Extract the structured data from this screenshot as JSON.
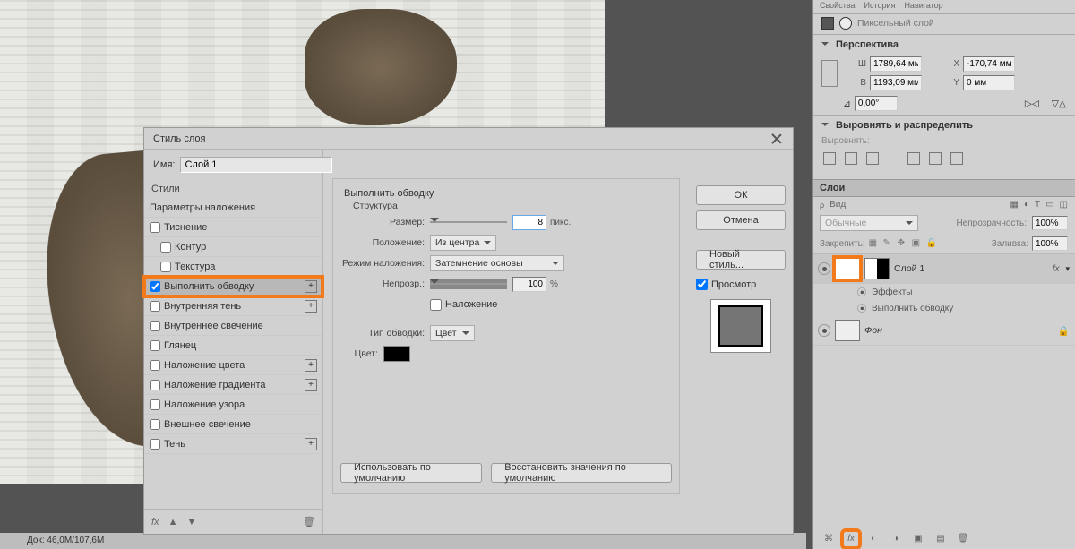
{
  "status_bar": {
    "doc_info": "Док: 46,0M/107,6M"
  },
  "dialog": {
    "title": "Стиль слоя",
    "name_label": "Имя:",
    "name_value": "Слой 1",
    "styles_header": "Стили",
    "effects": {
      "blending": "Параметры наложения",
      "bevel": "Тиснение",
      "contour": "Контур",
      "texture": "Текстура",
      "stroke": "Выполнить обводку",
      "inner_shadow": "Внутренняя тень",
      "inner_glow": "Внутреннее свечение",
      "satin": "Глянец",
      "color_overlay": "Наложение цвета",
      "gradient_overlay": "Наложение градиента",
      "pattern_overlay": "Наложение узора",
      "outer_glow": "Внешнее свечение",
      "drop_shadow": "Тень"
    },
    "stroke_panel": {
      "title": "Выполнить обводку",
      "structure": "Структура",
      "size_label": "Размер:",
      "size_value": "8",
      "size_unit": "пикс.",
      "position_label": "Положение:",
      "position_value": "Из центра",
      "blend_label": "Режим наложения:",
      "blend_value": "Затемнение основы",
      "opacity_label": "Непрозр.:",
      "opacity_value": "100",
      "opacity_unit": "%",
      "overprint": "Наложение",
      "type_label": "Тип обводки:",
      "type_value": "Цвет",
      "color_label": "Цвет:",
      "make_default": "Использовать по умолчанию",
      "reset_default": "Восстановить значения по умолчанию"
    },
    "buttons": {
      "ok": "ОК",
      "cancel": "Отмена",
      "new_style": "Новый стиль...",
      "preview": "Просмотр"
    },
    "footer_fx": "fx"
  },
  "panel": {
    "tabs": [
      "Свойства",
      "История",
      "Навигатор"
    ],
    "layer_kind": "Пиксельный слой",
    "perspective": {
      "title": "Перспектива",
      "w_label": "Ш",
      "w_value": "1789,64 мм",
      "x_label": "X",
      "x_value": "-170,74 мм",
      "h_label": "В",
      "h_value": "1193,09 мм",
      "y_label": "Y",
      "y_value": "0 мм",
      "angle_value": "0,00°"
    },
    "align": {
      "title": "Выровнять и распределить",
      "sub": "Выровнять:"
    },
    "layers": {
      "title": "Слои",
      "kind": "Вид",
      "blend_mode": "Обычные",
      "opacity_label": "Непрозрачность:",
      "opacity_value": "100%",
      "lock_label": "Закрепить:",
      "fill_label": "Заливка:",
      "fill_value": "100%",
      "layer1": "Слой 1",
      "effects_label": "Эффекты",
      "stroke_effect": "Выполнить обводку",
      "background": "Фон",
      "fx": "fx"
    }
  }
}
